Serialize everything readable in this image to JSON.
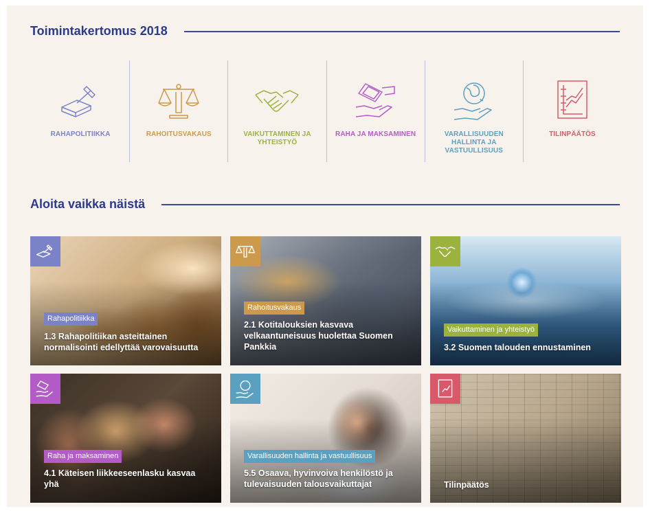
{
  "colors": {
    "heading": "#2c3a8c",
    "rahapolitiikka": "#7b82c8",
    "rahoitusvakaus": "#cc9a4a",
    "vaikuttaminen": "#9cb23f",
    "raha": "#b35cc8",
    "varallisuus": "#5aa0c0",
    "tilinpaatos": "#d85a6a"
  },
  "section1": {
    "title": "Toimintakertomus 2018"
  },
  "categories": [
    {
      "label": "RAHAPOLITIIKKA",
      "icon": "gavel-icon"
    },
    {
      "label": "RAHOITUSVAKAUS",
      "icon": "scales-icon"
    },
    {
      "label": "VAIKUTTAMINEN JA YHTEISTYÖ",
      "icon": "handshake-icon"
    },
    {
      "label": "RAHA JA MAKSAMINEN",
      "icon": "money-hands-icon"
    },
    {
      "label": "VARALLISUUDEN HALLINTA JA VASTUULLISUUS",
      "icon": "globe-hand-icon"
    },
    {
      "label": "TILINPÄÄTÖS",
      "icon": "chart-document-icon"
    }
  ],
  "section2": {
    "title": "Aloita vaikka näistä"
  },
  "cards": [
    {
      "tag": "Rahapolitiikka",
      "title": "1.3 Rahapolitiikan asteittainen normalisointi edellyttää varovaisuutta"
    },
    {
      "tag": "Rahoitusvakaus",
      "title": "2.1 Kotitalouksien kasvava velkaantuneisuus huolettaa Suomen Pankkia"
    },
    {
      "tag": "Vaikuttaminen ja yhteistyö",
      "title": "3.2 Suomen talouden ennustaminen"
    },
    {
      "tag": "Raha ja maksaminen",
      "title": "4.1 Käteisen liikkeeseenlasku kasvaa yhä"
    },
    {
      "tag": "Varallisuuden hallinta ja vastuullisuus",
      "title": "5.5 Osaava, hyvinvoiva henkilöstö ja tulevaisuuden talousvaikuttajat"
    },
    {
      "tag": "",
      "title": "Tilinpäätös"
    }
  ]
}
